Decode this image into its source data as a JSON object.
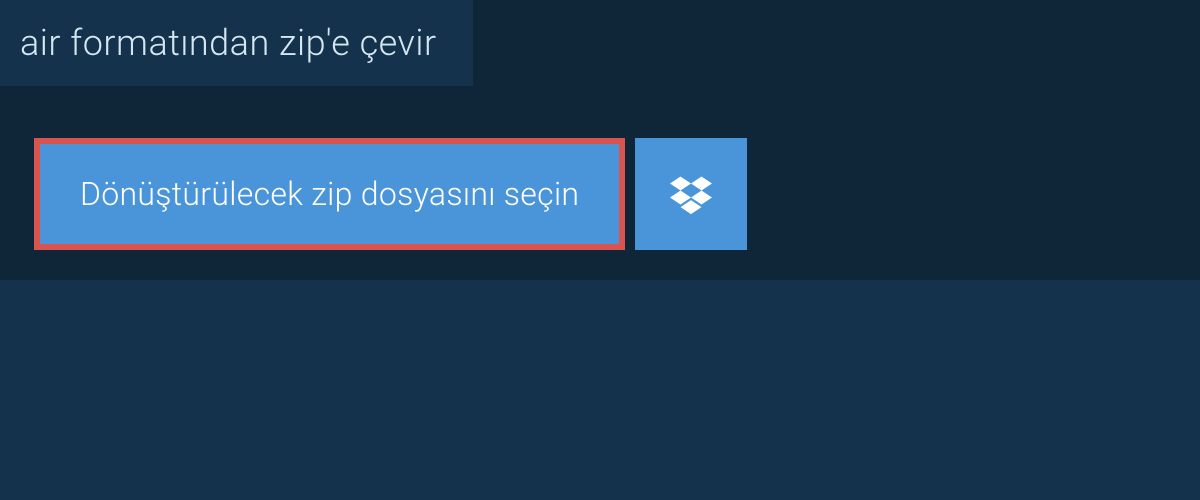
{
  "title": "air formatından zip'e çevir",
  "select_button_label": "Dönüştürülecek zip dosyasını seçin",
  "colors": {
    "background_outer": "#14324b",
    "background_panel": "#0f2639",
    "button_bg": "#4a95d9",
    "button_highlight_border": "#d9534f",
    "text_light": "#ffffff",
    "title_text": "#d4e6f1"
  }
}
